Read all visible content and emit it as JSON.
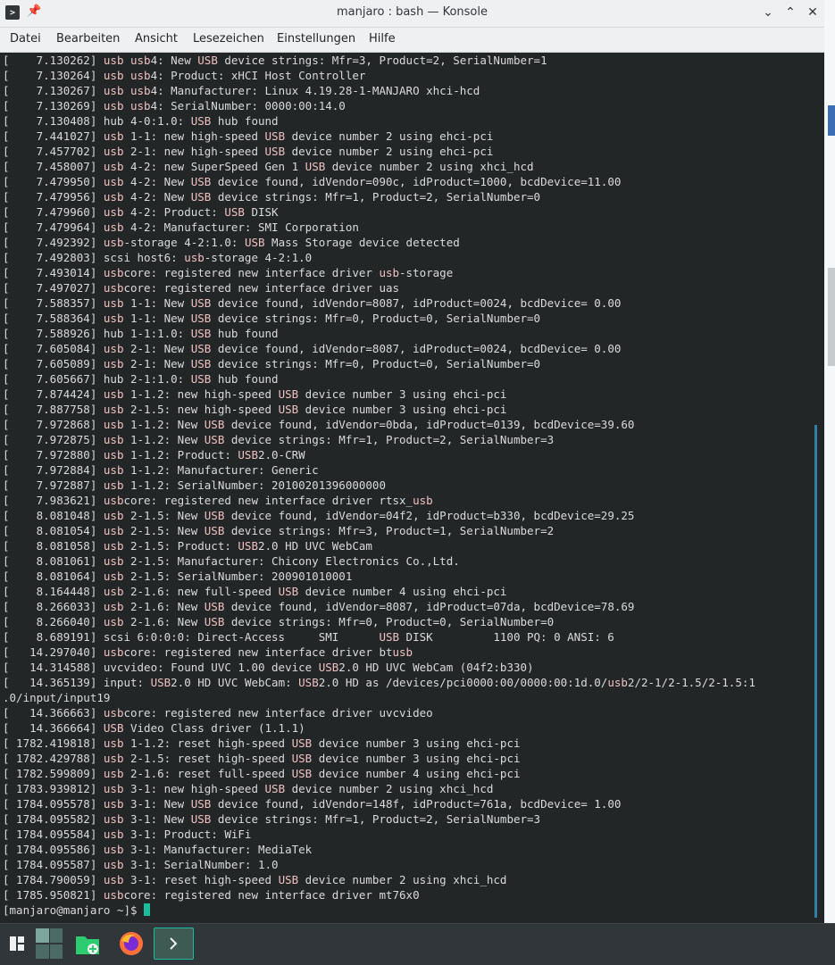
{
  "window": {
    "title": "manjaro : bash — Konsole",
    "app_icon": "terminal-icon",
    "pin_icon": "pin-icon",
    "buttons": {
      "minimize": "⌄",
      "maximize": "⌃",
      "close": "✕"
    }
  },
  "menu": [
    "Datei",
    "Bearbeiten",
    "Ansicht",
    "Lesezeichen",
    "Einstellungen",
    "Hilfe"
  ],
  "terminal": {
    "lines": [
      "[    7.130262] usb usb4: New USB device strings: Mfr=3, Product=2, SerialNumber=1",
      "[    7.130264] usb usb4: Product: xHCI Host Controller",
      "[    7.130267] usb usb4: Manufacturer: Linux 4.19.28-1-MANJARO xhci-hcd",
      "[    7.130269] usb usb4: SerialNumber: 0000:00:14.0",
      "[    7.130408] hub 4-0:1.0: USB hub found",
      "[    7.441027] usb 1-1: new high-speed USB device number 2 using ehci-pci",
      "[    7.457702] usb 2-1: new high-speed USB device number 2 using ehci-pci",
      "[    7.458007] usb 4-2: new SuperSpeed Gen 1 USB device number 2 using xhci_hcd",
      "[    7.479950] usb 4-2: New USB device found, idVendor=090c, idProduct=1000, bcdDevice=11.00",
      "[    7.479956] usb 4-2: New USB device strings: Mfr=1, Product=2, SerialNumber=0",
      "[    7.479960] usb 4-2: Product: USB DISK",
      "[    7.479964] usb 4-2: Manufacturer: SMI Corporation",
      "[    7.492392] usb-storage 4-2:1.0: USB Mass Storage device detected",
      "[    7.492803] scsi host6: usb-storage 4-2:1.0",
      "[    7.493014] usbcore: registered new interface driver usb-storage",
      "[    7.497027] usbcore: registered new interface driver uas",
      "[    7.588357] usb 1-1: New USB device found, idVendor=8087, idProduct=0024, bcdDevice= 0.00",
      "[    7.588364] usb 1-1: New USB device strings: Mfr=0, Product=0, SerialNumber=0",
      "[    7.588926] hub 1-1:1.0: USB hub found",
      "[    7.605084] usb 2-1: New USB device found, idVendor=8087, idProduct=0024, bcdDevice= 0.00",
      "[    7.605089] usb 2-1: New USB device strings: Mfr=0, Product=0, SerialNumber=0",
      "[    7.605667] hub 2-1:1.0: USB hub found",
      "[    7.874424] usb 1-1.2: new high-speed USB device number 3 using ehci-pci",
      "[    7.887758] usb 2-1.5: new high-speed USB device number 3 using ehci-pci",
      "[    7.972868] usb 1-1.2: New USB device found, idVendor=0bda, idProduct=0139, bcdDevice=39.60",
      "[    7.972875] usb 1-1.2: New USB device strings: Mfr=1, Product=2, SerialNumber=3",
      "[    7.972880] usb 1-1.2: Product: USB2.0-CRW",
      "[    7.972884] usb 1-1.2: Manufacturer: Generic",
      "[    7.972887] usb 1-1.2: SerialNumber: 20100201396000000",
      "[    7.983621] usbcore: registered new interface driver rtsx_usb",
      "[    8.081048] usb 2-1.5: New USB device found, idVendor=04f2, idProduct=b330, bcdDevice=29.25",
      "[    8.081054] usb 2-1.5: New USB device strings: Mfr=3, Product=1, SerialNumber=2",
      "[    8.081058] usb 2-1.5: Product: USB2.0 HD UVC WebCam",
      "[    8.081061] usb 2-1.5: Manufacturer: Chicony Electronics Co.,Ltd.",
      "[    8.081064] usb 2-1.5: SerialNumber: 200901010001",
      "[    8.164448] usb 2-1.6: new full-speed USB device number 4 using ehci-pci",
      "[    8.266033] usb 2-1.6: New USB device found, idVendor=8087, idProduct=07da, bcdDevice=78.69",
      "[    8.266040] usb 2-1.6: New USB device strings: Mfr=0, Product=0, SerialNumber=0",
      "[    8.689191] scsi 6:0:0:0: Direct-Access     SMI      USB DISK         1100 PQ: 0 ANSI: 6",
      "[   14.297040] usbcore: registered new interface driver btusb",
      "[   14.314588] uvcvideo: Found UVC 1.00 device USB2.0 HD UVC WebCam (04f2:b330)",
      "[   14.365139] input: USB2.0 HD UVC WebCam: USB2.0 HD as /devices/pci0000:00/0000:00:1d.0/usb2/2-1/2-1.5/2-1.5:1",
      ".0/input/input19",
      "[   14.366663] usbcore: registered new interface driver uvcvideo",
      "[   14.366664] USB Video Class driver (1.1.1)",
      "[ 1782.419818] usb 1-1.2: reset high-speed USB device number 3 using ehci-pci",
      "[ 1782.429788] usb 2-1.5: reset high-speed USB device number 3 using ehci-pci",
      "[ 1782.599809] usb 2-1.6: reset full-speed USB device number 4 using ehci-pci",
      "[ 1783.939812] usb 3-1: new high-speed USB device number 2 using xhci_hcd",
      "[ 1784.095578] usb 3-1: New USB device found, idVendor=148f, idProduct=761a, bcdDevice= 1.00",
      "[ 1784.095582] usb 3-1: New USB device strings: Mfr=1, Product=2, SerialNumber=3",
      "[ 1784.095584] usb 3-1: Product: WiFi",
      "[ 1784.095586] usb 3-1: Manufacturer: MediaTek",
      "[ 1784.095587] usb 3-1: SerialNumber: 1.0",
      "[ 1784.790059] usb 3-1: reset high-speed USB device number 2 using xhci_hcd",
      "[ 1785.950821] usbcore: registered new interface driver mt76x0"
    ],
    "prompt": "[manjaro@manjaro ~]$ "
  },
  "colors": {
    "terminal_bg": "#232627",
    "terminal_fg": "#d8dadc",
    "highlight": "#f0c0c0",
    "accent": "#1abc9c"
  },
  "taskbar": {
    "items": [
      {
        "name": "application-menu-icon",
        "active": false
      },
      {
        "name": "virtual-desktop-pager-icon",
        "active": false
      },
      {
        "name": "file-manager-icon",
        "active": false
      },
      {
        "name": "firefox-icon",
        "active": false
      },
      {
        "name": "konsole-icon",
        "active": true
      }
    ]
  }
}
